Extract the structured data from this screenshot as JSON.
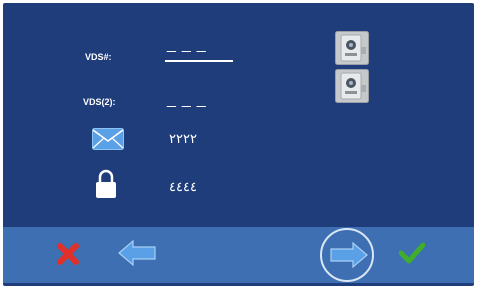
{
  "fields": [
    {
      "label": "VDS#:",
      "value": "___"
    },
    {
      "label": "VDS(2):",
      "value": "___"
    }
  ],
  "mail_value": "٢٢٢٢",
  "lock_value": "٤٤٤٤",
  "icons": {
    "camera_1": "camera-icon",
    "camera_2": "camera-icon",
    "mail": "mail-icon",
    "lock": "lock-icon",
    "cancel": "close-icon",
    "back": "arrow-left-icon",
    "next": "arrow-right-icon",
    "confirm": "check-icon"
  },
  "colors": {
    "panel": "#1f3d7a",
    "bottom_bar": "#3e6fb2",
    "cancel": "#e0302a",
    "confirm": "#3fae2a",
    "arrow": "#5aa0e6"
  }
}
